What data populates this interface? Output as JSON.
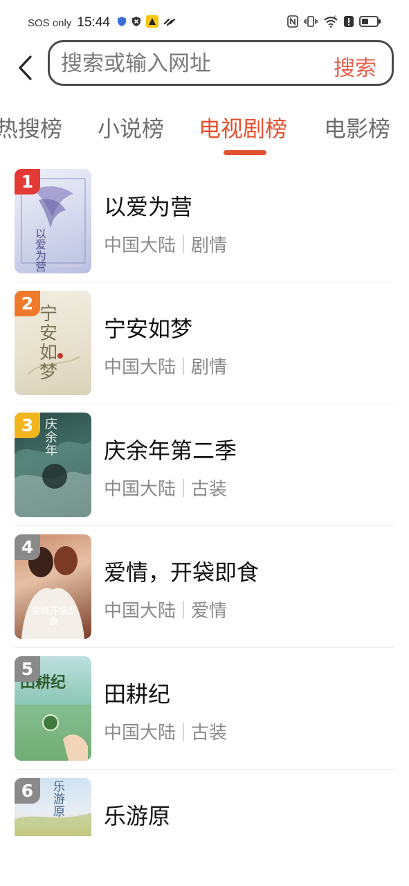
{
  "status_bar": {
    "carrier": "SOS only",
    "time": "15:44",
    "icons_left": [
      "shield-check-icon",
      "close-circle-icon",
      "yellow-app-icon",
      "link-icon"
    ],
    "icons_right": [
      "nfc-icon",
      "vibrate-icon",
      "wifi-icon",
      "alert-icon",
      "battery-icon"
    ]
  },
  "search": {
    "placeholder": "搜索或输入网址",
    "button_label": "搜索"
  },
  "tabs": [
    {
      "label": "热搜榜",
      "active": false
    },
    {
      "label": "小说榜",
      "active": false
    },
    {
      "label": "电视剧榜",
      "active": true
    },
    {
      "label": "电影榜",
      "active": false
    }
  ],
  "accent_color": "#e2512f",
  "ranking": [
    {
      "rank": "1",
      "title": "以爱为营",
      "region": "中国大陆",
      "genre": "剧情",
      "rank_color": "#e53935",
      "poster_text": "以爱为营"
    },
    {
      "rank": "2",
      "title": "宁安如梦",
      "region": "中国大陆",
      "genre": "剧情",
      "rank_color": "#f07a2c",
      "poster_text": "宁安如梦"
    },
    {
      "rank": "3",
      "title": "庆余年第二季",
      "region": "中国大陆",
      "genre": "古装",
      "rank_color": "#f2b51e",
      "poster_text": "庆余年"
    },
    {
      "rank": "4",
      "title": "爱情，开袋即食",
      "region": "中国大陆",
      "genre": "爱情",
      "rank_color": "#8a8a8a",
      "poster_text": "爱情开袋即食"
    },
    {
      "rank": "5",
      "title": "田耕纪",
      "region": "中国大陆",
      "genre": "古装",
      "rank_color": "#8a8a8a",
      "poster_text": "田耕纪"
    },
    {
      "rank": "6",
      "title": "乐游原",
      "region": "",
      "genre": "",
      "rank_color": "#8a8a8a",
      "poster_text": "乐游原"
    }
  ]
}
